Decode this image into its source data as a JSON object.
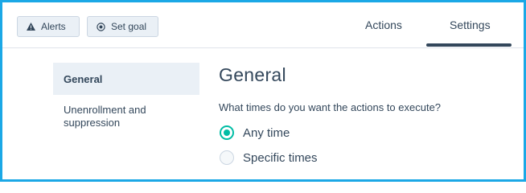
{
  "header": {
    "buttons": {
      "alerts_label": "Alerts",
      "alerts_icon": "warning-icon",
      "set_goal_label": "Set goal",
      "set_goal_icon": "target-icon"
    },
    "tabs": [
      {
        "label": "Actions",
        "active": false
      },
      {
        "label": "Settings",
        "active": true
      }
    ]
  },
  "sidebar": {
    "items": [
      {
        "label": "General",
        "active": true
      },
      {
        "label": "Unenrollment and suppression",
        "active": false
      }
    ]
  },
  "main": {
    "title": "General",
    "question": "What times do you want the actions to execute?",
    "options": [
      {
        "label": "Any time",
        "selected": true
      },
      {
        "label": "Specific times",
        "selected": false
      }
    ]
  },
  "colors": {
    "accent_radio": "#00bda5",
    "frame_border": "#1ba8e6",
    "text": "#33475b",
    "nav_active_bg": "#eaf0f6"
  }
}
